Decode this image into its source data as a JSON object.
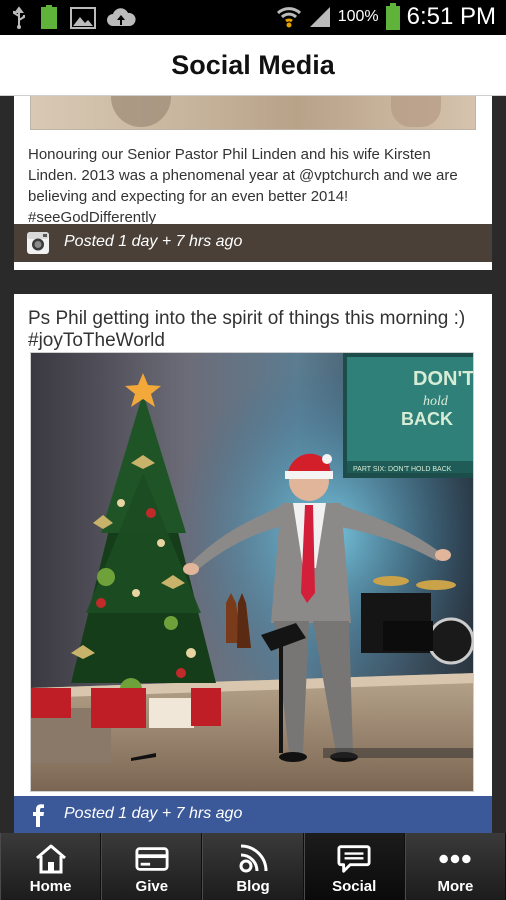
{
  "status_bar": {
    "battery_percent": "100%",
    "time": "6:51 PM",
    "left_icons": [
      "usb-icon",
      "battery-full-icon",
      "image-icon",
      "cloud-upload-icon"
    ],
    "right_icons": [
      "wifi-icon",
      "signal-icon",
      "battery-icon"
    ]
  },
  "header": {
    "title": "Social Media"
  },
  "posts": [
    {
      "caption": "Honouring our Senior Pastor Phil Linden and his wife Kirsten Linden. 2013 was a phenomenal year at @vptchurch and we are believing and expecting for an even better 2014! #seeGodDifferently",
      "source": "instagram",
      "posted": "Posted  1 day + 7 hrs ago",
      "bar_color": "#4a4038"
    },
    {
      "caption": "Ps Phil getting into the spirit of things this morning :) #joyToTheWorld",
      "source": "facebook",
      "posted": "Posted 1 day + 7 hrs ago",
      "bar_color": "#3b5998",
      "image": {
        "screen_text_line1": "DON'T",
        "screen_text_line2": "hold",
        "screen_text_line3": "BACK",
        "screen_caption": "PART SIX: DON'T HOLD BACK"
      }
    }
  ],
  "tabs": [
    {
      "label": "Home",
      "icon": "home-icon",
      "active": false
    },
    {
      "label": "Give",
      "icon": "credit-card-icon",
      "active": false
    },
    {
      "label": "Blog",
      "icon": "rss-icon",
      "active": false
    },
    {
      "label": "Social",
      "icon": "chat-bubble-icon",
      "active": true
    },
    {
      "label": "More",
      "icon": "more-dots-icon",
      "active": false
    }
  ]
}
